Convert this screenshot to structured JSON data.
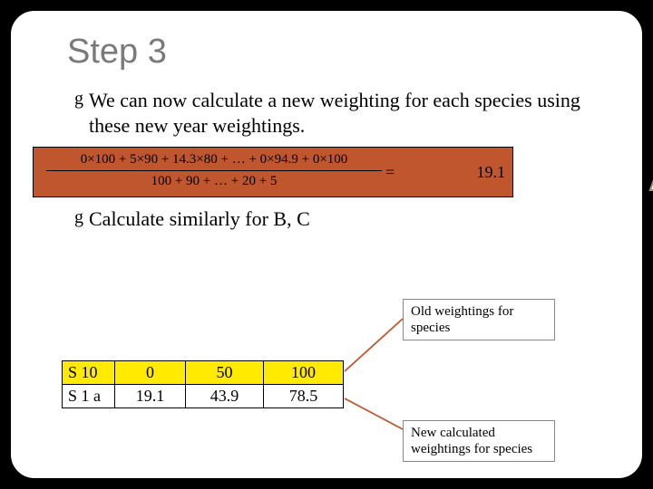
{
  "title": "Step 3",
  "bullets": {
    "b1": "We can now calculate a new weighting for each species using these new year weightings.",
    "b2": "Calculate similarly for B, C"
  },
  "bullet_glyph": "g",
  "formula": {
    "numerator": "0×100 + 5×90 + 14.3×80 + … + 0×94.9 + 0×100",
    "denominator": "100 + 90 + … + 20 + 5",
    "equals": "=",
    "result": "19.1",
    "species_letter": "A"
  },
  "annotations": {
    "old": "Old weightings for species",
    "new": "New calculated weightings for species"
  },
  "table": {
    "rows": [
      {
        "label": "S 10",
        "c1": "0",
        "c2": "50",
        "c3": "100",
        "highlight": true
      },
      {
        "label": "S 1 a",
        "c1": "19.1",
        "c2": "43.9",
        "c3": "78.5",
        "highlight": false
      }
    ]
  }
}
